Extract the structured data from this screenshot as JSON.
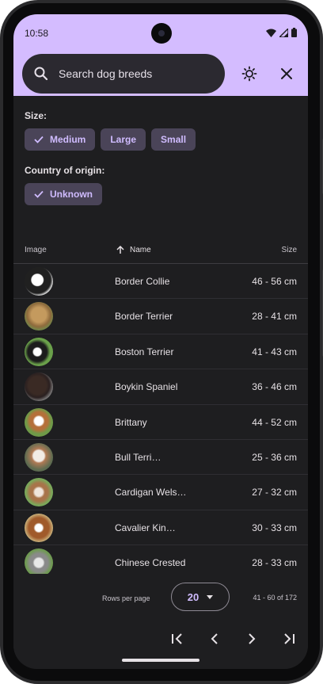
{
  "status_bar": {
    "time": "10:58"
  },
  "search": {
    "placeholder": "Search dog breeds"
  },
  "filters": {
    "size_label": "Size:",
    "size_chips": [
      {
        "label": "Medium",
        "selected": true
      },
      {
        "label": "Large",
        "selected": false
      },
      {
        "label": "Small",
        "selected": false
      }
    ],
    "origin_label": "Country of origin:",
    "origin_chips": [
      {
        "label": "Unknown",
        "selected": true
      }
    ]
  },
  "table": {
    "columns": {
      "image": "Image",
      "name": "Name",
      "size": "Size"
    },
    "sort": {
      "column": "name",
      "direction": "ascending"
    },
    "rows": [
      {
        "name": "Border Collie",
        "size": "46 - 56 cm"
      },
      {
        "name": "Border Terrier",
        "size": "28 - 41 cm"
      },
      {
        "name": "Boston Terrier",
        "size": "41 - 43 cm"
      },
      {
        "name": "Boykin Spaniel",
        "size": "36 - 46 cm"
      },
      {
        "name": "Brittany",
        "size": "44 - 52 cm"
      },
      {
        "name": "Bull Terri…",
        "size": "25 - 36 cm"
      },
      {
        "name": "Cardigan Wels…",
        "size": "27 - 32 cm"
      },
      {
        "name": "Cavalier Kin…",
        "size": "30 - 33 cm"
      },
      {
        "name": "Chinese Crested",
        "size": "28 - 33 cm"
      }
    ]
  },
  "pagination": {
    "rows_per_page_label": "Rows per page",
    "rows_per_page_value": "20",
    "range_text": "41 - 60 of 172"
  },
  "colors": {
    "top_bar": "#d4bcff",
    "chip_bg": "#4a4458",
    "chip_text": "#d0bcff",
    "surface": "#1e1e20"
  }
}
